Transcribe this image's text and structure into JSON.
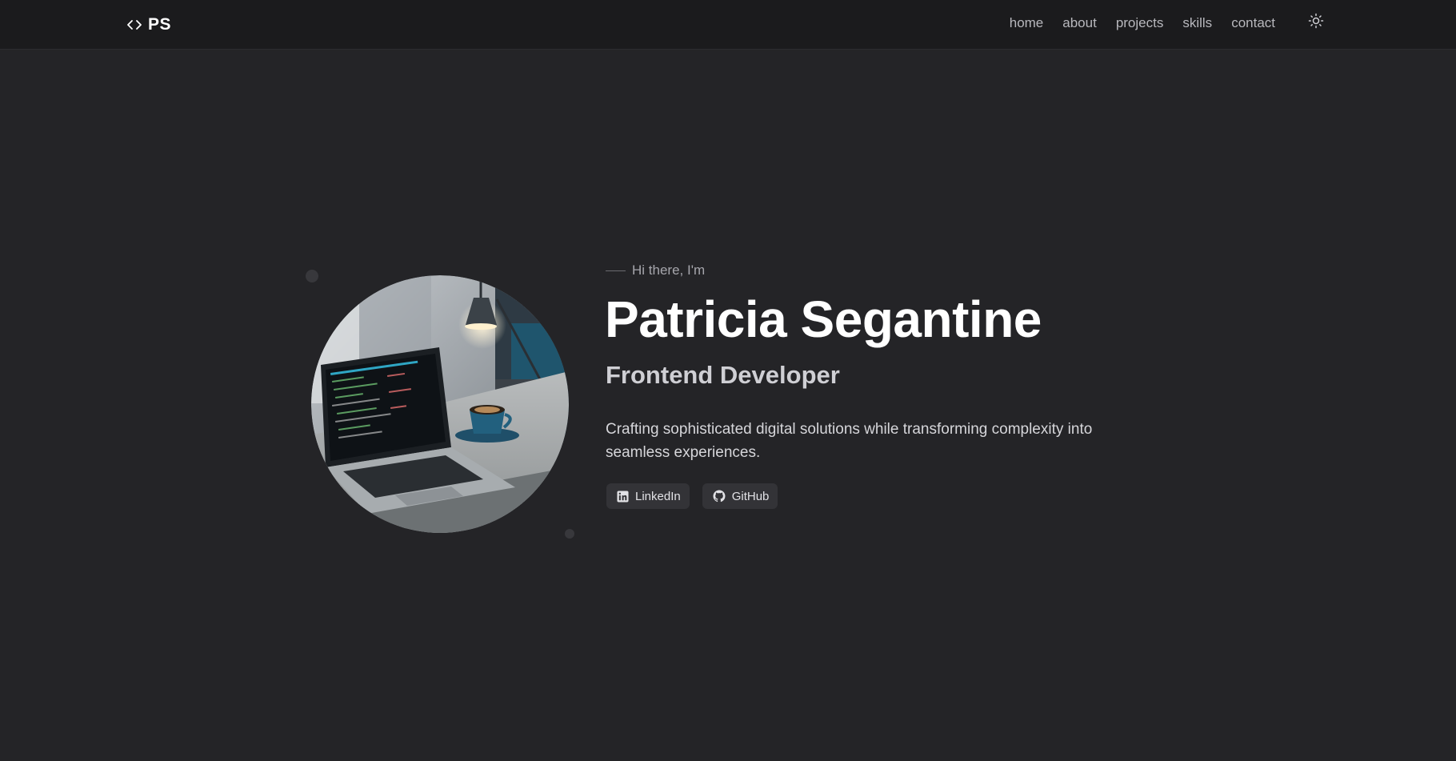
{
  "header": {
    "logo_text": "PS",
    "logo_icon": "code-brackets-icon",
    "nav": [
      {
        "label": "home"
      },
      {
        "label": "about"
      },
      {
        "label": "projects"
      },
      {
        "label": "skills"
      },
      {
        "label": "contact"
      }
    ],
    "theme_toggle_icon": "sun-icon"
  },
  "hero": {
    "greeting": "Hi there, I'm",
    "name": "Patricia Segantine",
    "role": "Frontend Developer",
    "tagline": "Crafting sophisticated digital solutions while transforming complexity into seamless experiences.",
    "image_description_icon": "laptop-desk-photo",
    "social": [
      {
        "label": "LinkedIn",
        "icon": "linkedin-icon"
      },
      {
        "label": "GitHub",
        "icon": "github-icon"
      }
    ]
  },
  "colors": {
    "background": "#242427",
    "navbar": "#1b1b1d",
    "text_primary": "#ffffff",
    "text_muted": "#b8b8bd",
    "button_bg": "#333337"
  }
}
